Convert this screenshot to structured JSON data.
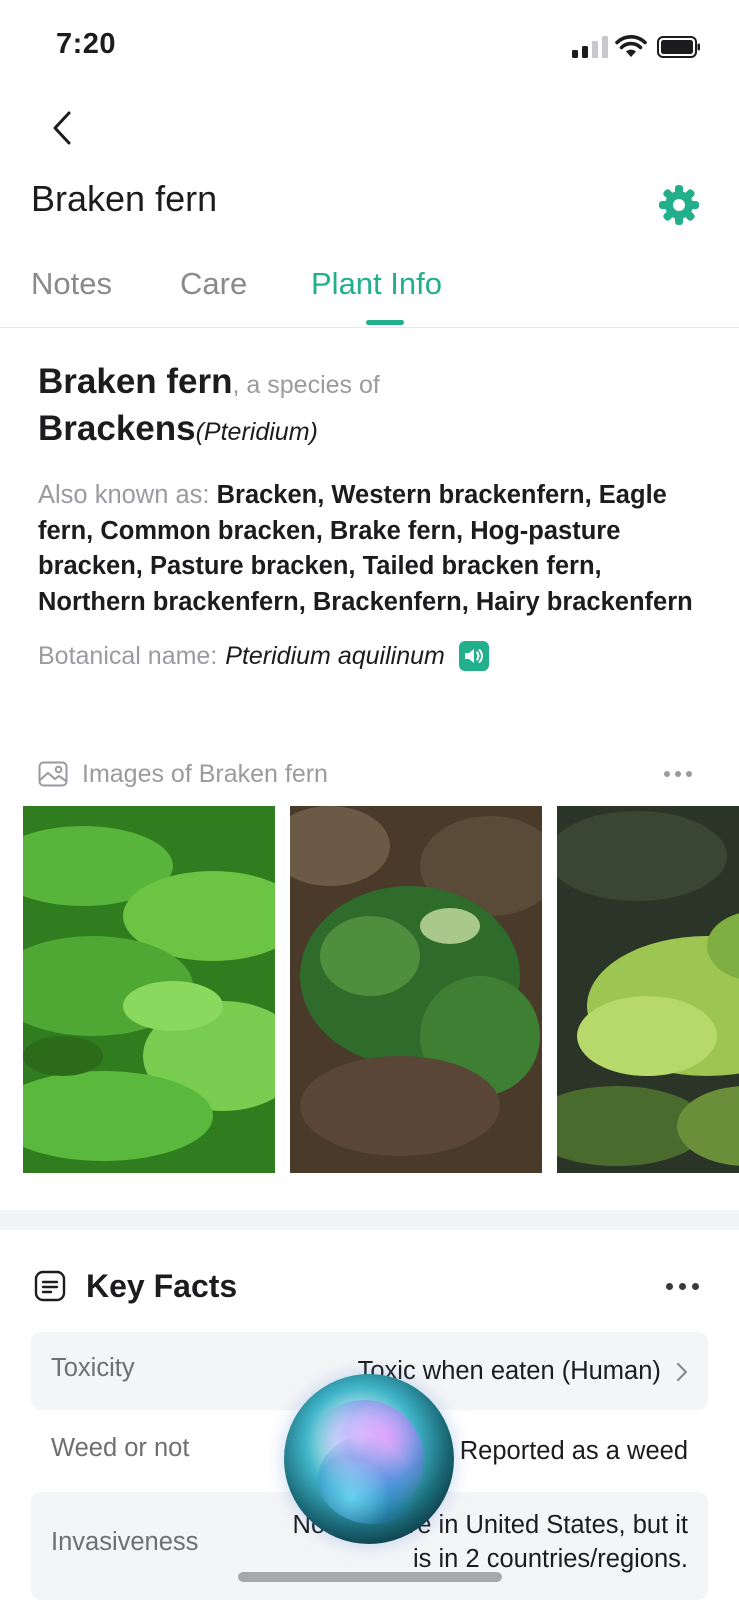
{
  "status_bar": {
    "time": "7:20"
  },
  "header": {
    "title": "Braken fern",
    "back_icon": "chevron-left-icon",
    "settings_icon": "gear-icon"
  },
  "tabs": [
    {
      "label": "Notes",
      "active": false
    },
    {
      "label": "Care",
      "active": false
    },
    {
      "label": "Plant Info",
      "active": true
    }
  ],
  "plant_info": {
    "common_name": "Braken fern",
    "species_of_text": ", a species of",
    "genus": "Brackens",
    "genus_latin": "(Pteridium)",
    "aka_label": "Also known as:",
    "aka_names": "Bracken, Western brackenfern, Eagle fern, Common bracken, Brake fern, Hog-pasture bracken, Pasture bracken, Tailed bracken fern, Northern brackenfern, Brackenfern, Hairy brackenfern",
    "botanical_label": "Botanical name:",
    "botanical_name": "Pteridium aquilinum",
    "speaker_icon": "speaker-icon"
  },
  "images": {
    "header_label": "Images of Braken fern",
    "header_icon": "image-icon",
    "more_icon": "more-horizontal-icon",
    "photos": [
      "fern-photo-1",
      "fern-photo-2",
      "fern-photo-3"
    ]
  },
  "key_facts": {
    "title": "Key Facts",
    "icon": "notes-icon",
    "more_icon": "more-horizontal-icon",
    "rows": [
      {
        "label": "Toxicity",
        "value": "Toxic when eaten (Human)"
      },
      {
        "label": "Weed or not",
        "value": "Reported as a weed"
      },
      {
        "label": "Invasiveness",
        "value_line1": "Not invasive in United States, but it",
        "value_line2": "is in 2 countries/regions."
      }
    ]
  },
  "colors": {
    "accent": "#21b08b",
    "muted_text": "#9a9aa0",
    "row_bg": "#f4f5f6"
  }
}
